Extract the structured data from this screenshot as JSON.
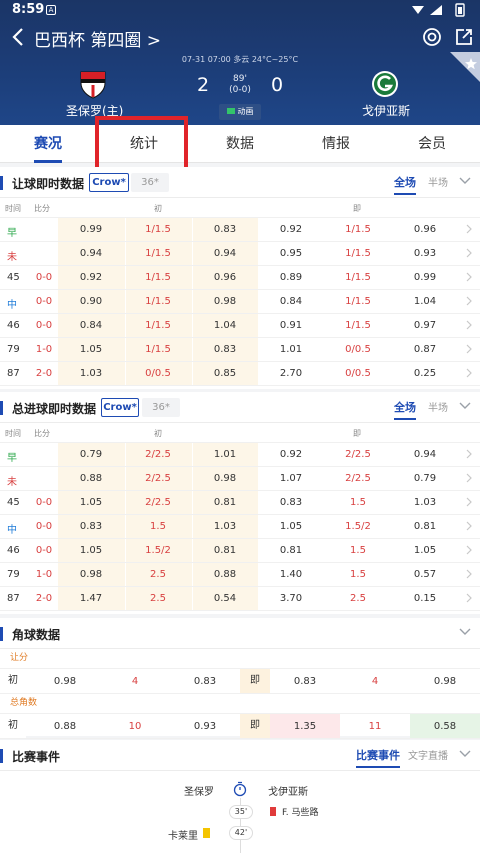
{
  "status_bar": {
    "time": "8:59",
    "notif_letter": "A"
  },
  "header": {
    "title": "巴西杯 第四圈 >",
    "info_line": "07-31 07:00   多云 24°C~25°C",
    "home_team": "圣保罗(主)",
    "away_team": "戈伊亚斯",
    "home_score": "2",
    "away_score": "0",
    "minute": "89'",
    "halftime": "(0-0)",
    "animation_label": "动画"
  },
  "tabs": [
    "赛况",
    "统计",
    "数据",
    "情报",
    "会员"
  ],
  "handicap": {
    "title": "让球即时数据",
    "chip_on": "Crow*",
    "chip_off": "36*",
    "scope_on": "全场",
    "scope_off": "半场",
    "col_time": "时间",
    "col_score": "比分",
    "col_initial": "初",
    "col_live": "即",
    "rows": [
      {
        "t": "早",
        "tc": "g",
        "s": "",
        "v": [
          "0.99",
          "1/1.5",
          "0.83",
          "0.92",
          "1/1.5",
          "0.96"
        ]
      },
      {
        "t": "未",
        "tc": "r",
        "s": "",
        "v": [
          "0.94",
          "1/1.5",
          "0.94",
          "0.95",
          "1/1.5",
          "0.93"
        ]
      },
      {
        "t": "45",
        "tc": "",
        "s": "0-0",
        "v": [
          "0.92",
          "1/1.5",
          "0.96",
          "0.89",
          "1/1.5",
          "0.99"
        ]
      },
      {
        "t": "中",
        "tc": "b",
        "s": "0-0",
        "v": [
          "0.90",
          "1/1.5",
          "0.98",
          "0.84",
          "1/1.5",
          "1.04"
        ]
      },
      {
        "t": "46",
        "tc": "",
        "s": "0-0",
        "v": [
          "0.84",
          "1/1.5",
          "1.04",
          "0.91",
          "1/1.5",
          "0.97"
        ]
      },
      {
        "t": "79",
        "tc": "",
        "s": "1-0",
        "v": [
          "1.05",
          "1/1.5",
          "0.83",
          "1.01",
          "0/0.5",
          "0.87"
        ]
      },
      {
        "t": "87",
        "tc": "",
        "s": "2-0",
        "v": [
          "1.03",
          "0/0.5",
          "0.85",
          "2.70",
          "0/0.5",
          "0.25"
        ]
      }
    ]
  },
  "totals": {
    "title": "总进球即时数据",
    "chip_on": "Crow*",
    "chip_off": "36*",
    "scope_on": "全场",
    "scope_off": "半场",
    "col_time": "时间",
    "col_score": "比分",
    "col_initial": "初",
    "col_live": "即",
    "rows": [
      {
        "t": "早",
        "tc": "g",
        "s": "",
        "v": [
          "0.79",
          "2/2.5",
          "1.01",
          "0.92",
          "2/2.5",
          "0.94"
        ]
      },
      {
        "t": "未",
        "tc": "r",
        "s": "",
        "v": [
          "0.88",
          "2/2.5",
          "0.98",
          "1.07",
          "2/2.5",
          "0.79"
        ]
      },
      {
        "t": "45",
        "tc": "",
        "s": "0-0",
        "v": [
          "1.05",
          "2/2.5",
          "0.81",
          "0.83",
          "1.5",
          "1.03"
        ]
      },
      {
        "t": "中",
        "tc": "b",
        "s": "0-0",
        "v": [
          "0.83",
          "1.5",
          "1.03",
          "1.05",
          "1.5/2",
          "0.81"
        ]
      },
      {
        "t": "46",
        "tc": "",
        "s": "0-0",
        "v": [
          "1.05",
          "1.5/2",
          "0.81",
          "0.81",
          "1.5",
          "1.05"
        ]
      },
      {
        "t": "79",
        "tc": "",
        "s": "1-0",
        "v": [
          "0.98",
          "2.5",
          "0.88",
          "1.40",
          "1.5",
          "0.57"
        ]
      },
      {
        "t": "87",
        "tc": "",
        "s": "2-0",
        "v": [
          "1.47",
          "2.5",
          "0.54",
          "3.70",
          "2.5",
          "0.15"
        ]
      }
    ]
  },
  "corners": {
    "title": "角球数据",
    "handicap_label": "让分",
    "total_label": "总角数",
    "initial_label": "初",
    "live_label": "即",
    "handicap_row": [
      "0.98",
      "4",
      "0.83",
      "0.83",
      "4",
      "0.98"
    ],
    "total_row": [
      "0.88",
      "10",
      "0.93",
      "1.35",
      "11",
      "0.58"
    ]
  },
  "events": {
    "title": "比赛事件",
    "tab_on": "比赛事件",
    "tab_off": "文字直播",
    "home": "圣保罗",
    "away": "戈伊亚斯",
    "e1_min": "35'",
    "e1_player": "F. 马些路",
    "e2_min": "42'",
    "e2_player": "卡莱里"
  }
}
